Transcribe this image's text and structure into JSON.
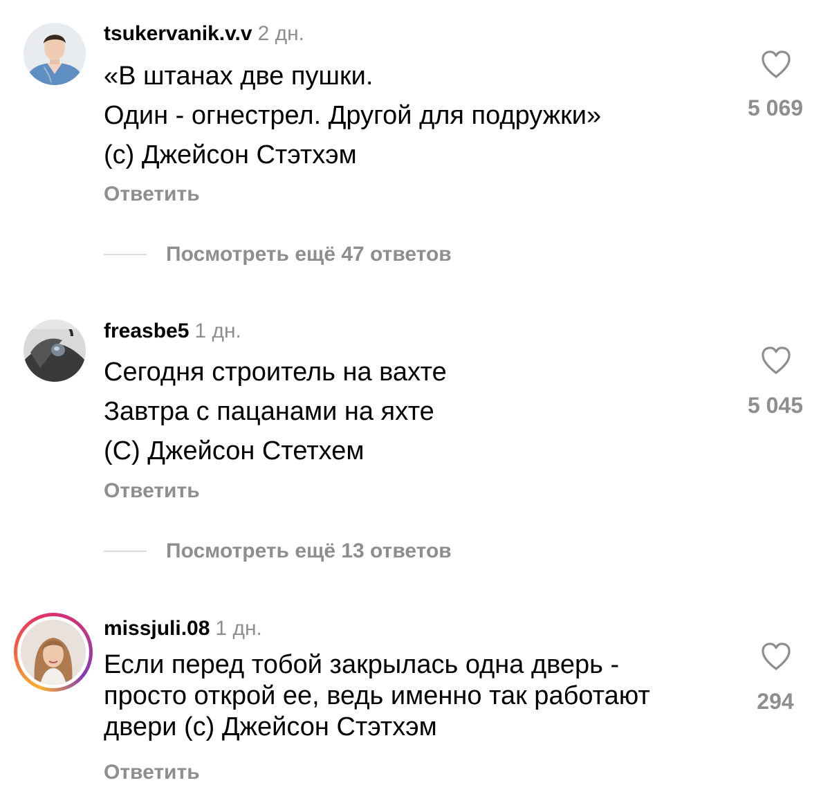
{
  "comments": [
    {
      "username": "tsukervanik.v.v",
      "time": "2 дн.",
      "lines": [
        "«В штанах две пушки.",
        "Один - огнестрел. Другой для подружки»",
        "(с) Джейсон Стэтхэм"
      ],
      "reply_label": "Ответить",
      "likes": "5 069",
      "view_replies": "Посмотреть ещё 47 ответов"
    },
    {
      "username": "freasbe5",
      "time": "1 дн.",
      "lines": [
        "Сегодня строитель на вахте",
        "Завтра с пацанами на яхте",
        "(С) Джейсон Стетхем"
      ],
      "reply_label": "Ответить",
      "likes": "5 045",
      "view_replies": "Посмотреть ещё 13 ответов"
    },
    {
      "username": "missjuli.08",
      "time": "1 дн.",
      "lines": [
        "Если перед тобой закрылась одна дверь -",
        "просто открой ее, ведь именно так работают",
        "двери (с) Джейсон Стэтхэм"
      ],
      "reply_label": "Ответить",
      "likes": "294"
    }
  ],
  "icons": {
    "like": "heart-outline-icon"
  },
  "colors": {
    "secondary_text": "#8e8e8e",
    "primary_text": "#000000",
    "divider": "#dbdbdb",
    "story_ring": [
      "#f9b233",
      "#f56040",
      "#e1306c",
      "#c13584",
      "#833ab4"
    ]
  }
}
